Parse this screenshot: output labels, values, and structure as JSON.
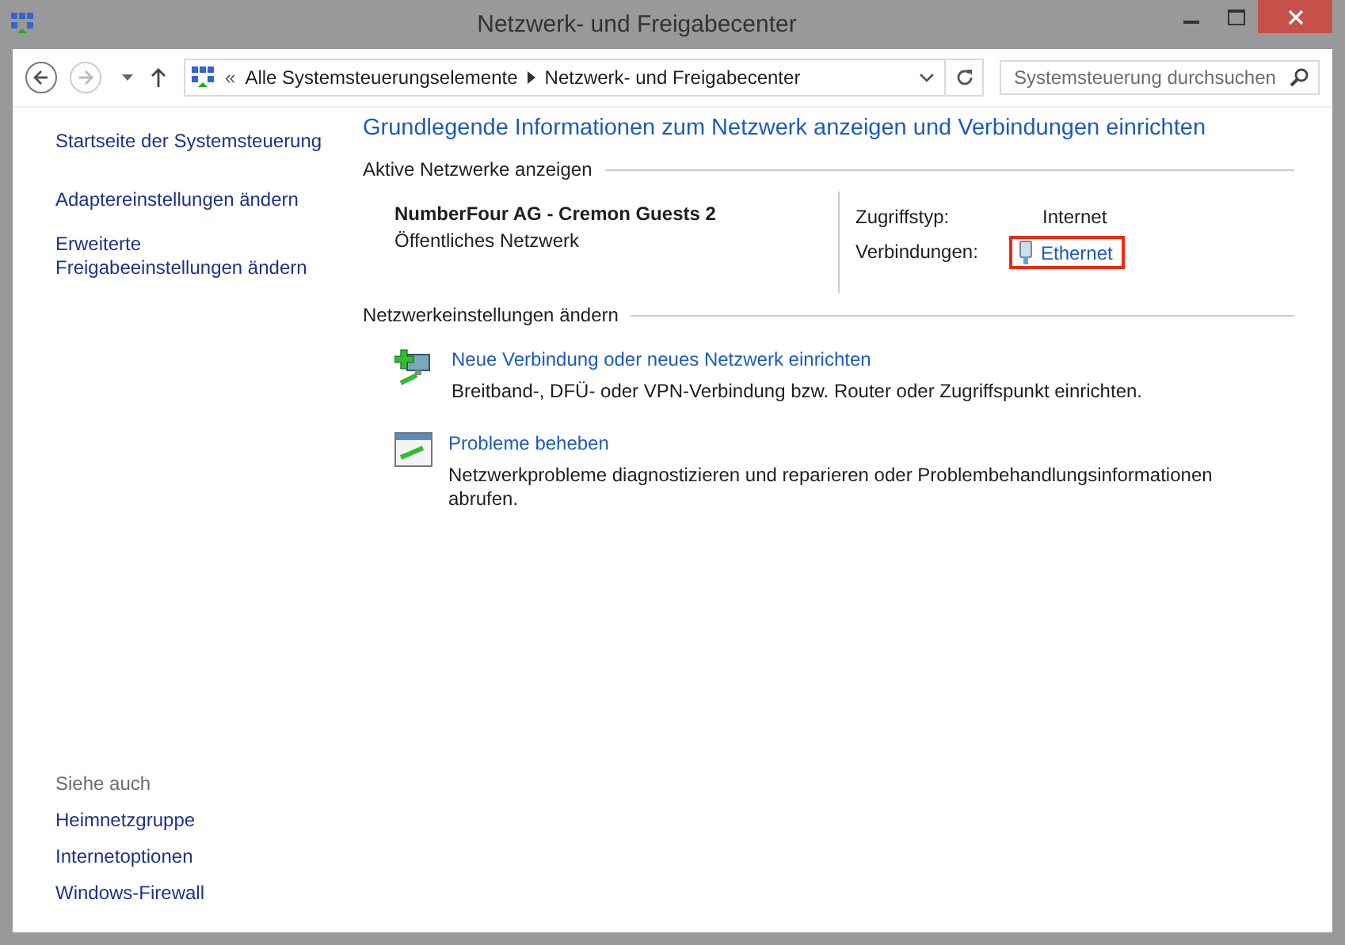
{
  "window": {
    "title": "Netzwerk- und Freigabecenter"
  },
  "nav": {
    "back_disabled": false,
    "forward_disabled": true
  },
  "breadcrumb": {
    "overflow": "«",
    "items": [
      "Alle Systemsteuerungselemente",
      "Netzwerk- und Freigabecenter"
    ]
  },
  "search": {
    "placeholder": "Systemsteuerung durchsuchen"
  },
  "sidebar": {
    "items": [
      "Startseite der Systemsteuerung",
      "Adaptereinstellungen ändern",
      "Erweiterte Freigabeeinstellungen ändern"
    ],
    "see_also": {
      "heading": "Siehe auch",
      "items": [
        "Heimnetzgruppe",
        "Internetoptionen",
        "Windows-Firewall"
      ]
    }
  },
  "main": {
    "heading": "Grundlegende Informationen zum Netzwerk anzeigen und Verbindungen einrichten",
    "active_networks": {
      "heading": "Aktive Netzwerke anzeigen",
      "network_name": "NumberFour AG - Cremon Guests  2",
      "network_type": "Öffentliches Netzwerk",
      "access_label": "Zugriffstyp:",
      "access_value": "Internet",
      "connections_label": "Verbindungen:",
      "connection": {
        "label": "Ethernet",
        "highlighted": true
      }
    },
    "change_settings": {
      "heading": "Netzwerkeinstellungen ändern",
      "tasks": [
        {
          "kind": "new-connection",
          "title": "Neue Verbindung oder neues Netzwerk einrichten",
          "description": "Breitband-, DFÜ- oder VPN-Verbindung bzw. Router oder Zugriffspunkt einrichten."
        },
        {
          "kind": "troubleshoot",
          "title": "Probleme beheben",
          "description": "Netzwerkprobleme diagnostizieren und reparieren oder Problembehandlungsinformationen abrufen."
        }
      ]
    }
  }
}
